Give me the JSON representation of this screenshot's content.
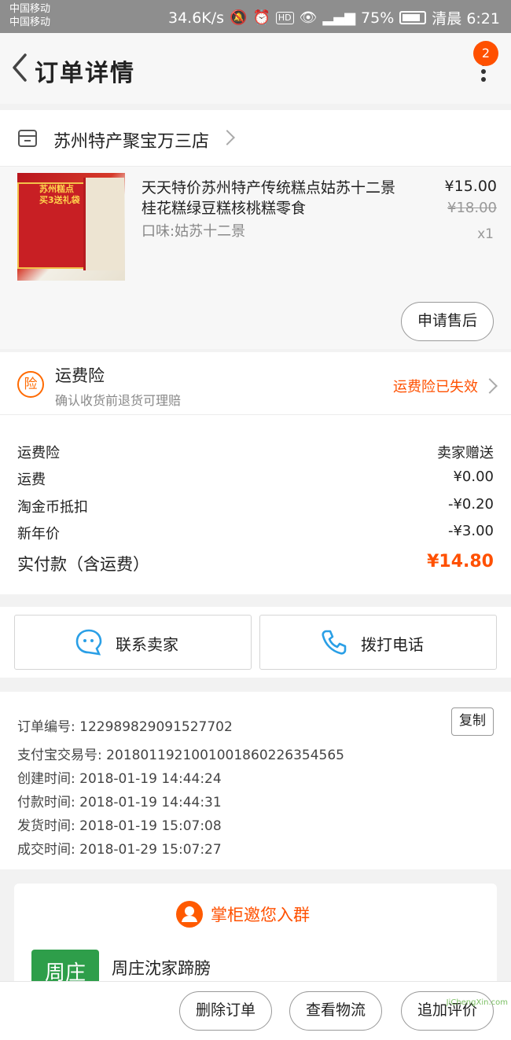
{
  "status_bar": {
    "carrier_1": "中国移动",
    "carrier_2": "中国移动",
    "speed": "34.6K/s",
    "hd": "HD",
    "battery": "75%",
    "time": "清晨 6:21"
  },
  "nav": {
    "title": "订单详情",
    "badge": "2"
  },
  "shop": {
    "name": "苏州特产聚宝万三店"
  },
  "product": {
    "image_caption": "苏州糕点\n买3送礼袋",
    "title": "天天特价苏州特产传统糕点姑苏十二景桂花糕绿豆糕核桃糕零食",
    "spec": "口味:姑苏十二景",
    "price": "¥15.00",
    "original_price": "¥18.00",
    "quantity": "x1",
    "after_sale_label": "申请售后"
  },
  "insurance": {
    "icon_text": "险",
    "title": "运费险",
    "subtitle": "确认收货前退货可理赔",
    "status": "运费险已失效"
  },
  "costs": [
    {
      "label": "运费险",
      "value": "卖家赠送"
    },
    {
      "label": "运费",
      "value": "¥0.00"
    },
    {
      "label": "淘金币抵扣",
      "value": "-¥0.20"
    },
    {
      "label": "新年价",
      "value": "-¥3.00"
    }
  ],
  "total": {
    "label": "实付款（含运费）",
    "value": "¥14.80"
  },
  "contact": {
    "seller_label": "联系卖家",
    "call_label": "拨打电话"
  },
  "order_info": {
    "copy_label": "复制",
    "rows": [
      "订单编号: 122989829091527702",
      "支付宝交易号: 2018011921001001860226354565",
      "创建时间: 2018-01-19 14:44:24",
      "付款时间: 2018-01-19 14:44:31",
      "发货时间: 2018-01-19 15:07:08",
      "成交时间: 2018-01-29 15:07:27"
    ]
  },
  "group": {
    "title": "掌柜邀您入群",
    "logo_text": "周庄",
    "name": "周庄沈家蹄膀"
  },
  "bottom_actions": {
    "delete": "删除订单",
    "logistics": "查看物流",
    "review": "追加评价"
  },
  "watermark": "JiChengXin.com",
  "colors": {
    "accent": "#ff5000",
    "status_bar": "#8e8e8e",
    "group_logo": "#2e9e4a"
  }
}
